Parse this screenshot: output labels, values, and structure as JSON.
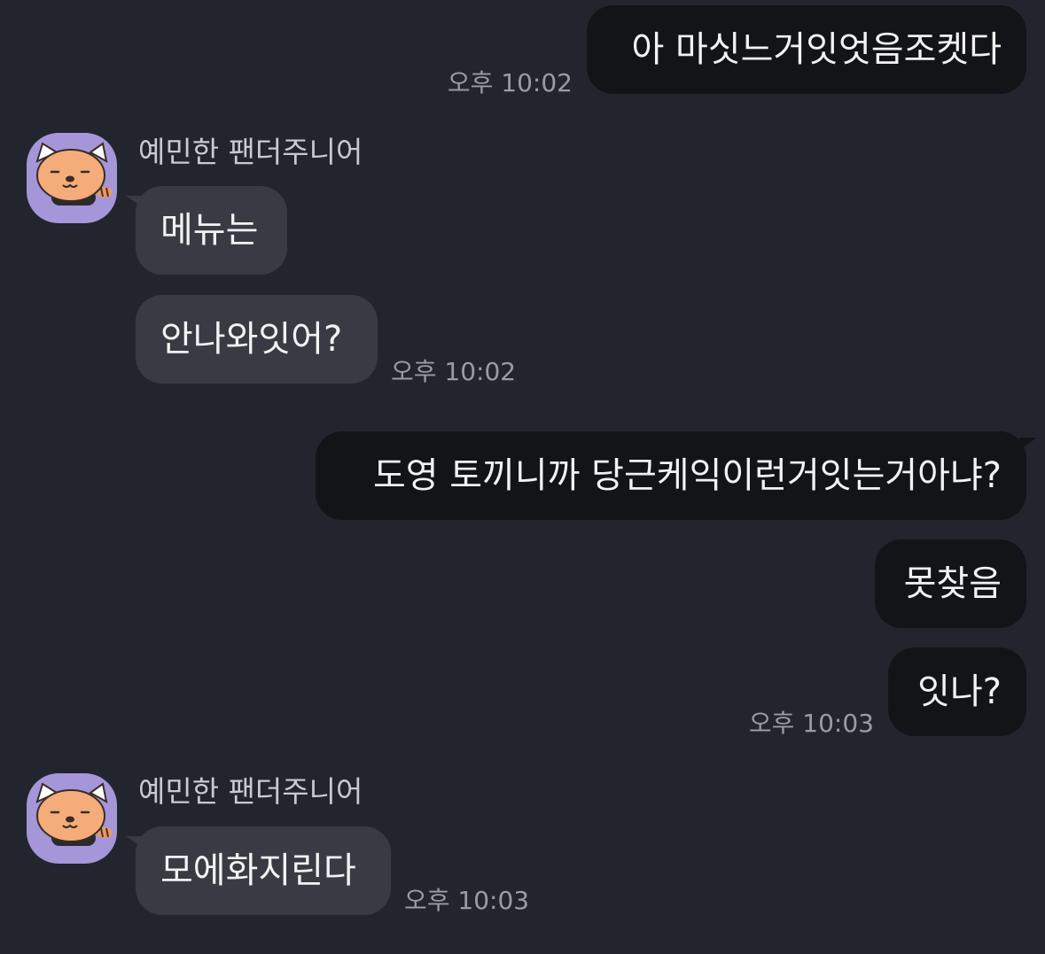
{
  "colors": {
    "background": "#22252d",
    "outgoing_bubble": "#131418",
    "incoming_bubble": "#383b44",
    "avatar_bg": "#a596d9",
    "timestamp": "#9a9ca2"
  },
  "messages": [
    {
      "direction": "out",
      "text": "아 마싯느거잇엇음조켓다",
      "time": "오후 10:02"
    },
    {
      "direction": "in",
      "sender": "예민한 팬더주니어",
      "text": "메뉴는",
      "avatar_icon": "red-panda-avatar-icon"
    },
    {
      "direction": "in",
      "text": "안나와잇어?",
      "time": "오후 10:02"
    },
    {
      "direction": "out",
      "text": "도영 토끼니까 당근케익이런거잇는거아냐?"
    },
    {
      "direction": "out",
      "text": "못찾음"
    },
    {
      "direction": "out",
      "text": "잇나?",
      "time": "오후 10:03"
    },
    {
      "direction": "in",
      "sender": "예민한 팬더주니어",
      "text": "모에화지린다",
      "time": "오후 10:03",
      "avatar_icon": "red-panda-avatar-icon"
    }
  ]
}
